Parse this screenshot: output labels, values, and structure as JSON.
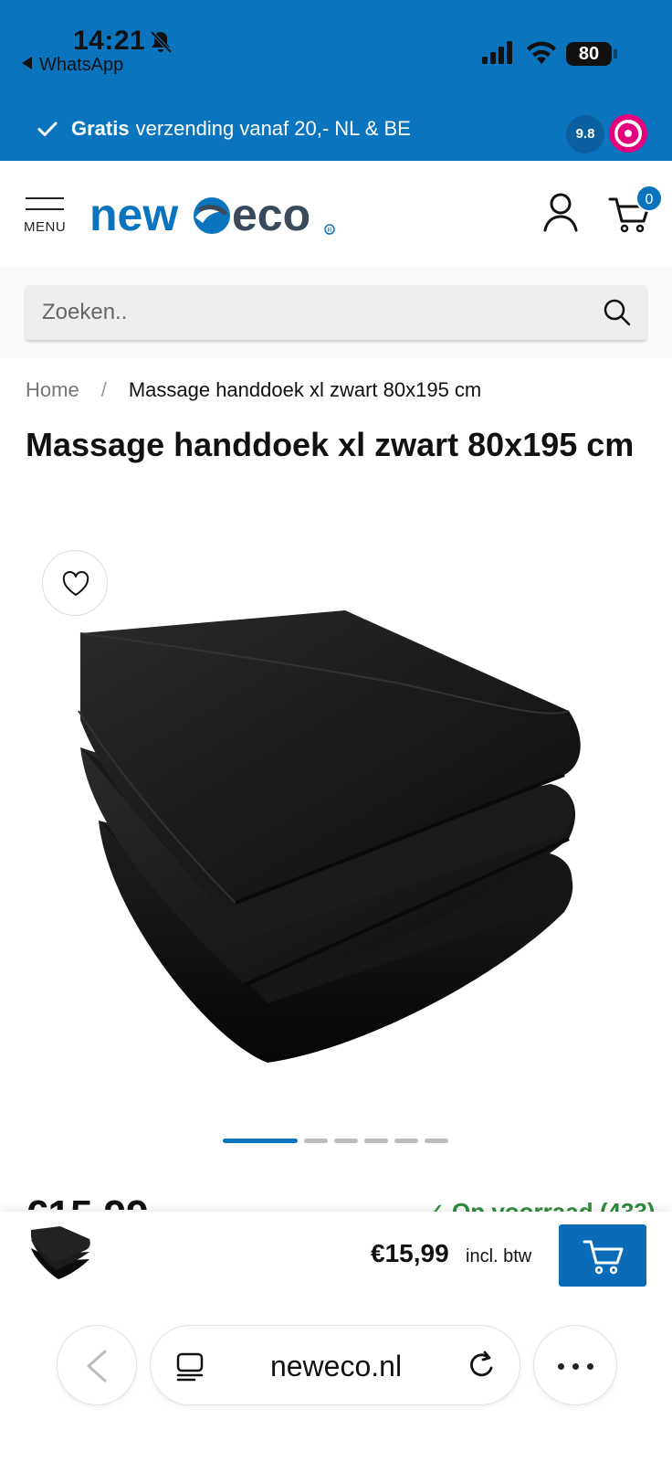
{
  "status_bar": {
    "time": "14:21",
    "back_app": "WhatsApp",
    "battery": "80"
  },
  "promo": {
    "bold": "Gratis",
    "text": "verzending vanaf 20,- NL & BE",
    "rating": "9.8"
  },
  "header": {
    "menu_label": "MENU",
    "cart_count": "0"
  },
  "search": {
    "placeholder": "Zoeken.."
  },
  "breadcrumb": {
    "home": "Home",
    "separator": "/",
    "current": "Massage handdoek xl zwart 80x195 cm"
  },
  "product": {
    "title": "Massage handdoek xl zwart 80x195 cm",
    "price": "€15,99",
    "stock": "✓ Op voorraad (433)",
    "gallery_slides": 6,
    "gallery_active": 1
  },
  "sticky": {
    "price": "€15,99",
    "tax": "incl. btw"
  },
  "browser": {
    "url": "neweco.nl"
  },
  "colors": {
    "brand_blue": "#0a74bf",
    "stock_green": "#2e8b3d"
  },
  "icons": [
    "bell-slash-icon",
    "signal-icon",
    "wifi-icon",
    "check-icon",
    "hamburger-icon",
    "user-icon",
    "cart-icon",
    "search-icon",
    "heart-icon",
    "chevron-left-icon",
    "tabs-icon",
    "reload-icon",
    "more-icon"
  ]
}
